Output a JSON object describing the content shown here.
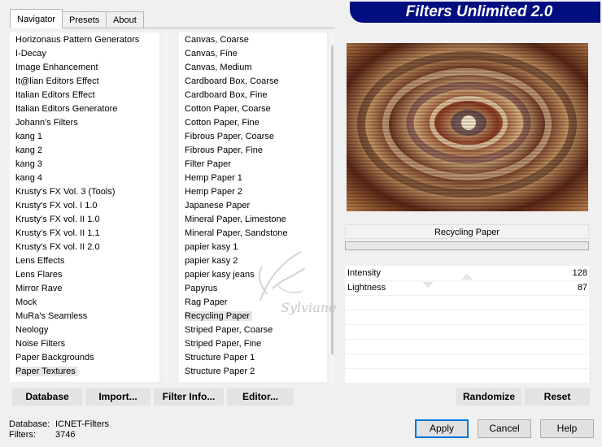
{
  "tabs": [
    "Navigator",
    "Presets",
    "About"
  ],
  "app_title": "Filters Unlimited 2.0",
  "categories": [
    "Horizonaus Pattern Generators",
    "I-Decay",
    "Image Enhancement",
    "It@lian Editors Effect",
    "Italian Editors Effect",
    "Italian Editors Generatore",
    "Johann's Filters",
    "kang 1",
    "kang 2",
    "kang 3",
    "kang 4",
    "Krusty's FX Vol. 3 (Tools)",
    "Krusty's FX vol. I 1.0",
    "Krusty's FX vol. II 1.0",
    "Krusty's FX vol. II 1.1",
    "Krusty's FX vol. II 2.0",
    "Lens Effects",
    "Lens Flares",
    "Mirror Rave",
    "Mock",
    "MuRa's Seamless",
    "Neology",
    "Noise Filters",
    "Paper Backgrounds",
    "Paper Textures"
  ],
  "selected_category": "Paper Textures",
  "filters": [
    "Canvas, Coarse",
    "Canvas, Fine",
    "Canvas, Medium",
    "Cardboard Box, Coarse",
    "Cardboard Box, Fine",
    "Cotton Paper, Coarse",
    "Cotton Paper, Fine",
    "Fibrous Paper, Coarse",
    "Fibrous Paper, Fine",
    "Filter Paper",
    "Hemp Paper 1",
    "Hemp Paper 2",
    "Japanese Paper",
    "Mineral Paper, Limestone",
    "Mineral Paper, Sandstone",
    "papier kasy 1",
    "papier kasy 2",
    "papier kasy jeans",
    "Papyrus",
    "Rag Paper",
    "Recycling Paper",
    "Striped Paper, Coarse",
    "Striped Paper, Fine",
    "Structure Paper 1",
    "Structure Paper 2"
  ],
  "selected_filter": "Recycling Paper",
  "filter_name": "Recycling Paper",
  "params": [
    {
      "name": "Intensity",
      "value": "128",
      "level": 0.5
    },
    {
      "name": "Lightness",
      "value": "87",
      "level": 0.34
    }
  ],
  "buttons": {
    "database": "Database",
    "import": "Import...",
    "filter_info": "Filter Info...",
    "editor": "Editor...",
    "randomize": "Randomize",
    "reset": "Reset",
    "apply": "Apply",
    "cancel": "Cancel",
    "help": "Help"
  },
  "info": {
    "database_label": "Database:",
    "database_value": "ICNET-Filters",
    "filters_label": "Filters:",
    "filters_value": "3746"
  },
  "watermark": "Sylviane",
  "colors": {
    "banner": "#000e80",
    "accent": "#0078d7"
  }
}
